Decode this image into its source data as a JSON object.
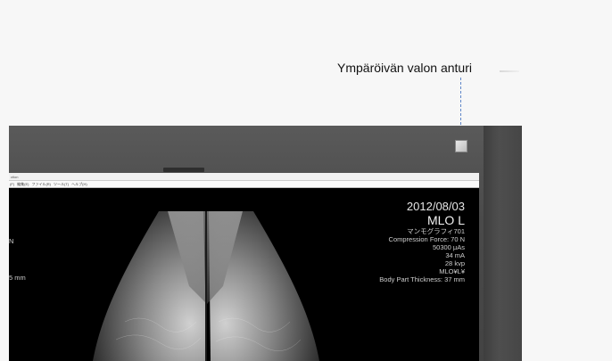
{
  "callout": {
    "label": "Ympäröivän valon anturi"
  },
  "app": {
    "title": "ction",
    "menu": [
      "(F)",
      "編集(E)",
      "ファイル(R)",
      "ツール(T)",
      "ヘルプ(H)"
    ]
  },
  "overlay": {
    "date": "2012/08/03",
    "view": "MLO L",
    "info_lines": [
      "マンモグラフィ701",
      "Compression Force: 70 N",
      "50300 μAs",
      "34 mA",
      "28 kvp",
      "MLO¥L¥",
      "Body Part Thickness: 37 mm"
    ],
    "left_lines": [
      "N",
      "5 mm"
    ]
  },
  "colors": {
    "bezel": "#4a4a4a",
    "screen_bg": "#000000",
    "callout_line": "#5f86c8",
    "sensor": "#d9d9d9"
  }
}
